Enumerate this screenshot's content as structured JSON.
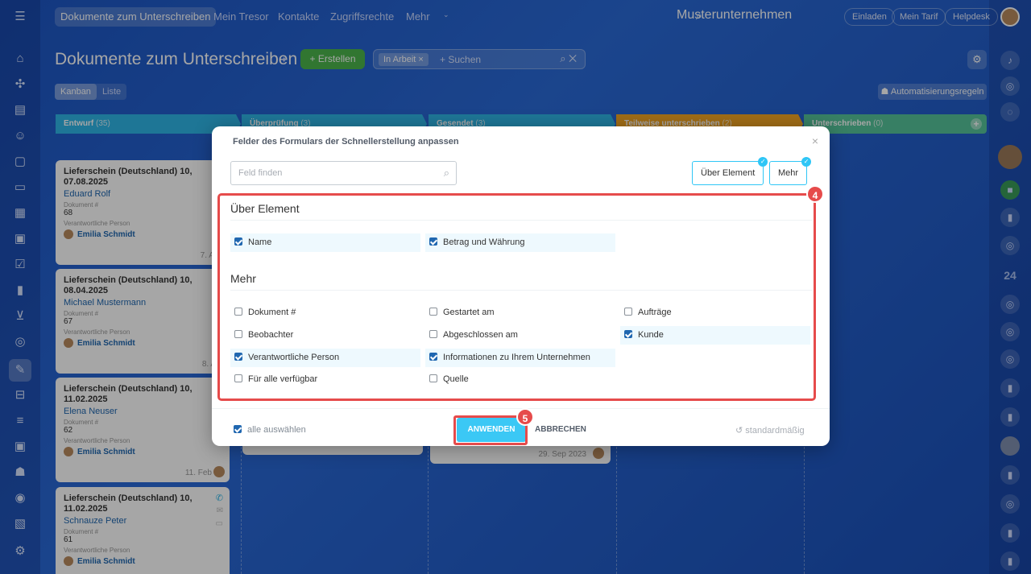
{
  "topnav": {
    "items": [
      "Dokumente zum Unterschreiben",
      "Mein Tresor",
      "Kontakte",
      "Zugriffsrechte",
      "Mehr"
    ],
    "company": "Musterunternehmen",
    "invite": "Einladen",
    "tariff": "Mein Tarif",
    "helpdesk": "Helpdesk"
  },
  "page": {
    "title": "Dokumente zum Unterschreiben",
    "create": "Erstellen",
    "filter_chip": "In Arbeit",
    "search_placeholder": "+ Suchen",
    "views": [
      "Kanban",
      "Liste"
    ],
    "automation": "Automatisierungsregeln"
  },
  "stages": [
    {
      "name": "Entwurf",
      "count": "(35)",
      "color": "#2fb5e6"
    },
    {
      "name": "Überprüfung",
      "count": "(3)",
      "color": "#2fb5e6"
    },
    {
      "name": "Gesendet",
      "count": "(3)",
      "color": "#2fb5e6"
    },
    {
      "name": "Teilweise unterschrieben",
      "count": "(2)",
      "color": "#f5a623"
    },
    {
      "name": "Unterschrieben",
      "count": "(0)",
      "color": "#55c49a"
    }
  ],
  "cards": [
    {
      "title": "Lieferschein (Deutschland) 10, 07.08.2025",
      "person": "Eduard Rolf",
      "doc_label": "Dokument #",
      "doc": "68",
      "resp_label": "Verantwortliche Person",
      "resp": "Emilia Schmidt",
      "date": "7. Aug"
    },
    {
      "title": "Lieferschein (Deutschland) 10, 08.04.2025",
      "person": "Michael Mustermann",
      "doc_label": "Dokument #",
      "doc": "67",
      "resp_label": "Verantwortliche Person",
      "resp": "Emilia Schmidt",
      "date": "8. Apr"
    },
    {
      "title": "Lieferschein (Deutschland) 10, 11.02.2025",
      "person": "Elena Neuser",
      "doc_label": "Dokument #",
      "doc": "62",
      "resp_label": "Verantwortliche Person",
      "resp": "Emilia Schmidt",
      "date": "11. Feb"
    },
    {
      "title": "Lieferschein (Deutschland) 10, 11.02.2025",
      "person": "Schnauze Peter",
      "doc_label": "Dokument #",
      "doc": "61",
      "resp_label": "Verantwortliche Person",
      "resp": "Emilia Schmidt",
      "date": ""
    }
  ],
  "side_date": "29. Sep 2023",
  "modal": {
    "title": "Felder des Formulars der Schnellerstellung anpassen",
    "search_placeholder": "Feld finden",
    "tags": [
      "Über Element",
      "Mehr"
    ],
    "sections": [
      {
        "title": "Über Element",
        "options": [
          {
            "label": "Name",
            "checked": true
          },
          {
            "label": "Betrag und Währung",
            "checked": true
          }
        ]
      },
      {
        "title": "Mehr",
        "options": [
          {
            "label": "Dokument #",
            "checked": false
          },
          {
            "label": "Gestartet am",
            "checked": false
          },
          {
            "label": "Aufträge",
            "checked": false
          },
          {
            "label": "Beobachter",
            "checked": false
          },
          {
            "label": "Abgeschlossen am",
            "checked": false
          },
          {
            "label": "Kunde",
            "checked": true
          },
          {
            "label": "Verantwortliche Person",
            "checked": true
          },
          {
            "label": "Informationen zu Ihrem Unternehmen",
            "checked": true
          },
          {
            "label": "Für alle verfügbar",
            "checked": false
          },
          {
            "label": "Quelle",
            "checked": false
          }
        ]
      }
    ],
    "select_all": "alle auswählen",
    "apply": "ANWENDEN",
    "cancel": "ABBRECHEN",
    "default": "standardmäßig"
  },
  "annotations": [
    "4",
    "5"
  ],
  "right_counter": "24"
}
